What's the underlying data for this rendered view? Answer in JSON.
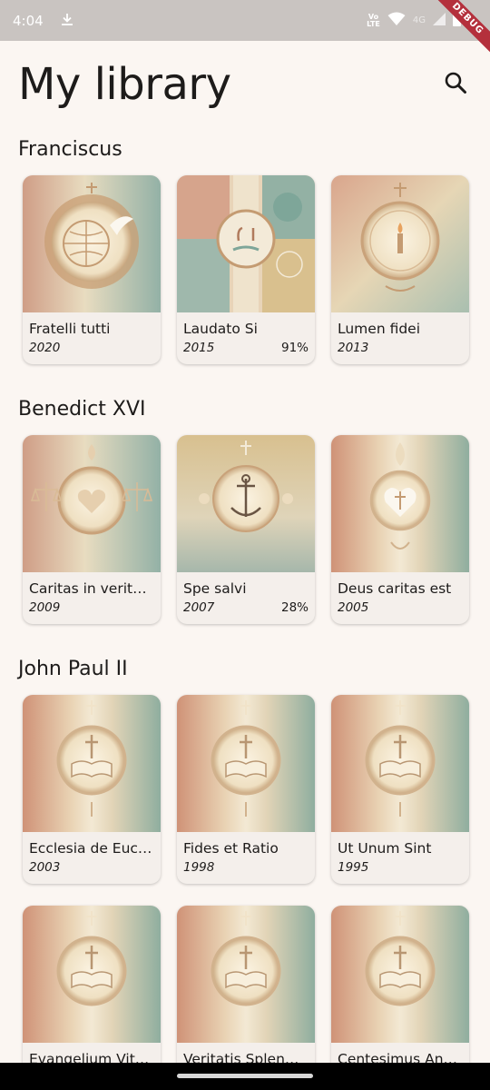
{
  "status_bar": {
    "time": "4:04",
    "volte_top": "Vo",
    "volte_mid": "LTE",
    "network": "4G",
    "debug_label": "DEBUG"
  },
  "header": {
    "title": "My library",
    "search_icon": "search-icon"
  },
  "sections": [
    {
      "title": "Franciscus",
      "books": [
        {
          "title": "Fratelli tutti",
          "year": "2020",
          "progress": ""
        },
        {
          "title": "Laudato Si",
          "year": "2015",
          "progress": "91%"
        },
        {
          "title": "Lumen fidei",
          "year": "2013",
          "progress": ""
        }
      ]
    },
    {
      "title": "Benedict XVI",
      "books": [
        {
          "title": "Caritas in verit…",
          "year": "2009",
          "progress": ""
        },
        {
          "title": "Spe salvi",
          "year": "2007",
          "progress": "28%"
        },
        {
          "title": "Deus caritas est",
          "year": "2005",
          "progress": ""
        }
      ]
    },
    {
      "title": "John Paul II",
      "books": [
        {
          "title": "Ecclesia de Euc…",
          "year": "2003",
          "progress": ""
        },
        {
          "title": "Fides et Ratio",
          "year": "1998",
          "progress": ""
        },
        {
          "title": "Ut Unum Sint",
          "year": "1995",
          "progress": ""
        }
      ]
    },
    {
      "title": "",
      "books": [
        {
          "title": "Evangelium Vit…",
          "year": "",
          "progress": ""
        },
        {
          "title": "Veritatis Splen…",
          "year": "",
          "progress": ""
        },
        {
          "title": "Centesimus An…",
          "year": "",
          "progress": ""
        }
      ]
    }
  ],
  "colors": {
    "background": "#fbf6f2",
    "card": "#f4efeb",
    "status_bar": "#c9c4c1",
    "debug_banner": "#b4303c"
  }
}
